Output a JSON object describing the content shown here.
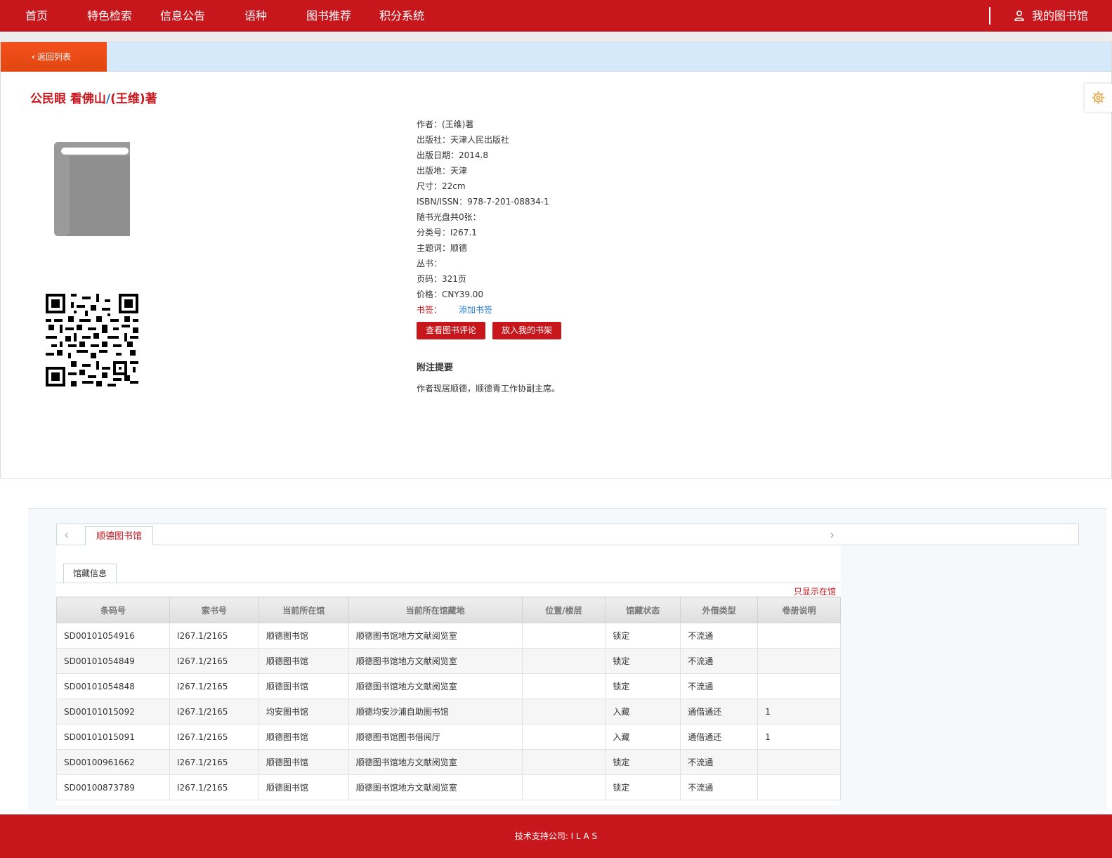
{
  "nav": {
    "items": [
      "首页",
      "特色检索",
      "信息公告",
      "语种",
      "图书推荐",
      "积分系统"
    ],
    "my_library": "我的图书馆"
  },
  "detail": {
    "back_label": "返回列表",
    "title_main": "公民眼 看佛山",
    "title_slash": "/",
    "title_author": "(王维)著",
    "meta": [
      "作者：(王维)著",
      "出版社：天津人民出版社",
      "出版日期：2014.8",
      "出版地：天津",
      "尺寸：22cm",
      "ISBN/ISSN：978-7-201-08834-1",
      "随书光盘共0张：",
      "分类号：I267.1",
      "主题词：顺德",
      "丛书：",
      "页码：321页",
      "价格：CNY39.00"
    ],
    "bookmark_label": "书签：",
    "bookmark_link": "添加书签",
    "btn_reviews": "查看图书评论",
    "btn_shelf": "放入我的书架",
    "notes_title": "附注提要",
    "notes_text": "作者现居顺德，顺德青工作协副主席。"
  },
  "holdings": {
    "library_tab": "顺德图书馆",
    "sub_tab": "馆藏信息",
    "only_available": "只显示在馆",
    "columns": [
      "条码号",
      "索书号",
      "当前所在馆",
      "当前所在馆藏地",
      "位置/楼层",
      "馆藏状态",
      "外借类型",
      "卷册说明"
    ],
    "rows": [
      [
        "SD00101054916",
        "I267.1/2165",
        "顺德图书馆",
        "顺德图书馆地方文献阅览室",
        "",
        "锁定",
        "不流通",
        ""
      ],
      [
        "SD00101054849",
        "I267.1/2165",
        "顺德图书馆",
        "顺德图书馆地方文献阅览室",
        "",
        "锁定",
        "不流通",
        ""
      ],
      [
        "SD00101054848",
        "I267.1/2165",
        "顺德图书馆",
        "顺德图书馆地方文献阅览室",
        "",
        "锁定",
        "不流通",
        ""
      ],
      [
        "SD00101015092",
        "I267.1/2165",
        "均安图书馆",
        "顺德均安沙浦自助图书馆",
        "",
        "入藏",
        "通借通还",
        "1"
      ],
      [
        "SD00101015091",
        "I267.1/2165",
        "顺德图书馆",
        "顺德图书馆图书借阅厅",
        "",
        "入藏",
        "通借通还",
        "1"
      ],
      [
        "SD00100961662",
        "I267.1/2165",
        "顺德图书馆",
        "顺德图书馆地方文献阅览室",
        "",
        "锁定",
        "不流通",
        ""
      ],
      [
        "SD00100873789",
        "I267.1/2165",
        "顺德图书馆",
        "顺德图书馆地方文献阅览室",
        "",
        "锁定",
        "不流通",
        ""
      ]
    ]
  },
  "footer": {
    "text": "技术支持公司: I L A S"
  },
  "colors": {
    "brand_red": "#c8161d",
    "back_orange": "#f04e1c",
    "link_blue": "#2b7fd8"
  }
}
